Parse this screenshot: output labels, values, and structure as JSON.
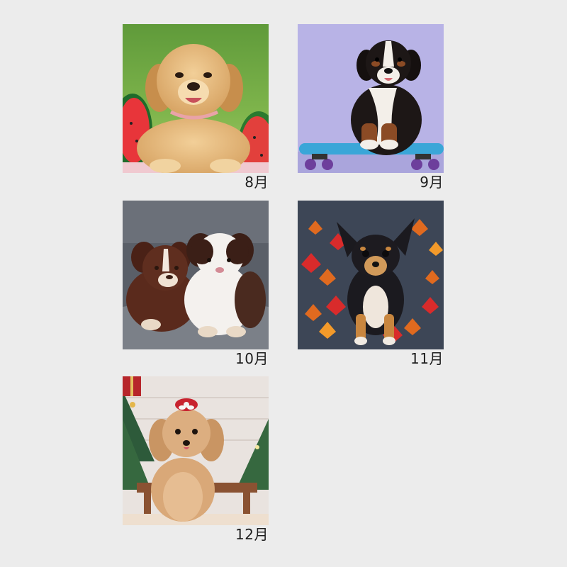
{
  "months": [
    {
      "id": "aug",
      "label": "8月",
      "subject": "golden-retriever-puppy-watermelon"
    },
    {
      "id": "sep",
      "label": "9月",
      "subject": "bernese-puppy-skateboard"
    },
    {
      "id": "oct",
      "label": "10月",
      "subject": "two-australian-shepherd-puppies"
    },
    {
      "id": "nov",
      "label": "11月",
      "subject": "chihuahua-autumn-leaves"
    },
    {
      "id": "dec",
      "label": "12月",
      "subject": "toy-poodle-christmas"
    }
  ],
  "colors": {
    "background": "#ececec",
    "caption": "#1d1d1d"
  }
}
